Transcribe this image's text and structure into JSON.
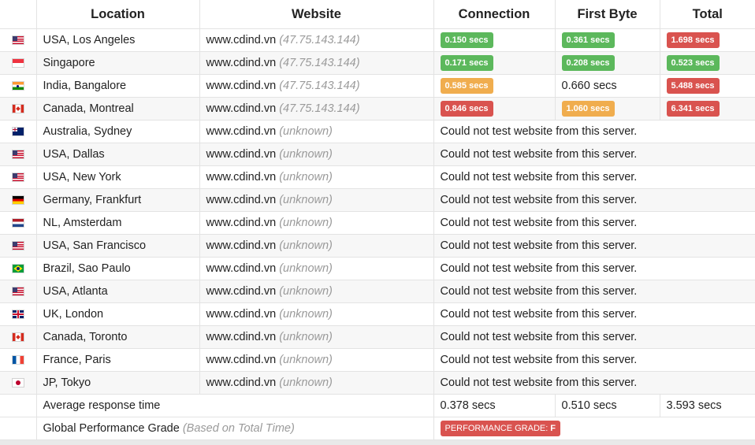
{
  "headers": {
    "location": "Location",
    "website": "Website",
    "connection": "Connection",
    "first_byte": "First Byte",
    "total": "Total"
  },
  "rows": [
    {
      "flag": "us-flag",
      "location": "USA, Los Angeles",
      "website": "www.cdind.vn",
      "ip": "(47.75.143.144)",
      "connection": "0.150 secs",
      "connection_status": "green",
      "first_byte": "0.361 secs",
      "first_byte_status": "green",
      "total": "1.698 secs",
      "total_status": "red"
    },
    {
      "flag": "sg-flag",
      "location": "Singapore",
      "website": "www.cdind.vn",
      "ip": "(47.75.143.144)",
      "connection": "0.171 secs",
      "connection_status": "green",
      "first_byte": "0.208 secs",
      "first_byte_status": "green",
      "total": "0.523 secs",
      "total_status": "green"
    },
    {
      "flag": "in-flag",
      "location": "India, Bangalore",
      "website": "www.cdind.vn",
      "ip": "(47.75.143.144)",
      "connection": "0.585 secs",
      "connection_status": "orange",
      "first_byte": "0.660 secs",
      "first_byte_status": "plain",
      "total": "5.488 secs",
      "total_status": "red"
    },
    {
      "flag": "ca-flag",
      "location": "Canada, Montreal",
      "website": "www.cdind.vn",
      "ip": "(47.75.143.144)",
      "connection": "0.846 secs",
      "connection_status": "red",
      "first_byte": "1.060 secs",
      "first_byte_status": "orange",
      "total": "6.341 secs",
      "total_status": "red"
    },
    {
      "flag": "au-flag",
      "location": "Australia, Sydney",
      "website": "www.cdind.vn",
      "ip": "(unknown)",
      "message": "Could not test website from this server."
    },
    {
      "flag": "us-flag",
      "location": "USA, Dallas",
      "website": "www.cdind.vn",
      "ip": "(unknown)",
      "message": "Could not test website from this server."
    },
    {
      "flag": "us-flag",
      "location": "USA, New York",
      "website": "www.cdind.vn",
      "ip": "(unknown)",
      "message": "Could not test website from this server."
    },
    {
      "flag": "de-flag",
      "location": "Germany, Frankfurt",
      "website": "www.cdind.vn",
      "ip": "(unknown)",
      "message": "Could not test website from this server."
    },
    {
      "flag": "nl-flag",
      "location": "NL, Amsterdam",
      "website": "www.cdind.vn",
      "ip": "(unknown)",
      "message": "Could not test website from this server."
    },
    {
      "flag": "us-flag",
      "location": "USA, San Francisco",
      "website": "www.cdind.vn",
      "ip": "(unknown)",
      "message": "Could not test website from this server."
    },
    {
      "flag": "br-flag",
      "location": "Brazil, Sao Paulo",
      "website": "www.cdind.vn",
      "ip": "(unknown)",
      "message": "Could not test website from this server."
    },
    {
      "flag": "us-flag",
      "location": "USA, Atlanta",
      "website": "www.cdind.vn",
      "ip": "(unknown)",
      "message": "Could not test website from this server."
    },
    {
      "flag": "gb-flag",
      "location": "UK, London",
      "website": "www.cdind.vn",
      "ip": "(unknown)",
      "message": "Could not test website from this server."
    },
    {
      "flag": "ca-flag",
      "location": "Canada, Toronto",
      "website": "www.cdind.vn",
      "ip": "(unknown)",
      "message": "Could not test website from this server."
    },
    {
      "flag": "fr-flag",
      "location": "France, Paris",
      "website": "www.cdind.vn",
      "ip": "(unknown)",
      "message": "Could not test website from this server."
    },
    {
      "flag": "jp-flag",
      "location": "JP, Tokyo",
      "website": "www.cdind.vn",
      "ip": "(unknown)",
      "message": "Could not test website from this server."
    }
  ],
  "average": {
    "label": "Average response time",
    "connection": "0.378 secs",
    "first_byte": "0.510 secs",
    "total": "3.593 secs"
  },
  "grade": {
    "label": "Global Performance Grade",
    "note": "(Based on Total Time)",
    "badge_label": "PERFORMANCE GRADE:",
    "badge_letter": "F"
  },
  "colors": {
    "green": "#5cb85c",
    "orange": "#f0ad4e",
    "red": "#d9534f"
  }
}
